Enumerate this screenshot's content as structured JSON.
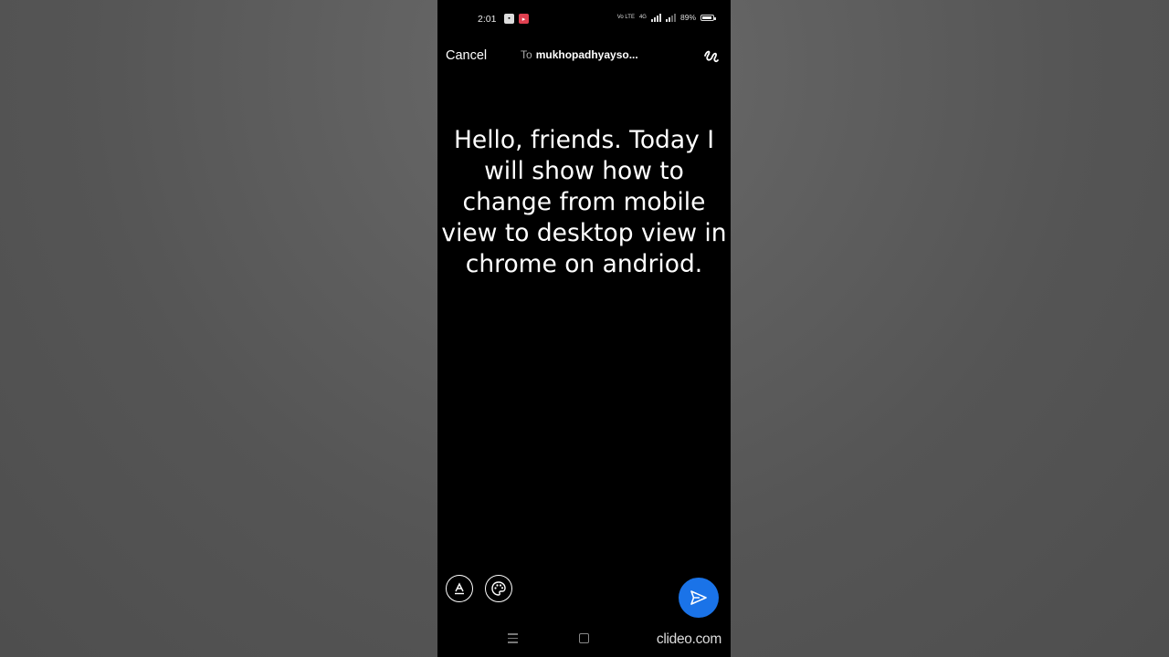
{
  "status_bar": {
    "time": "2:01",
    "notification_icons": [
      "chat-app-icon",
      "video-app-icon"
    ],
    "volte_label": "Vo LTE",
    "network_label": "4G",
    "battery_percent": "89%",
    "battery_level": 0.89
  },
  "compose": {
    "cancel_label": "Cancel",
    "to_label": "To",
    "recipient": "mukhopadhyayso...",
    "draw_icon": "squiggle-draw-icon"
  },
  "message": {
    "text": "Hello, friends. Today I will show how to change from mobile view to desktop view in chrome on andriod."
  },
  "toolbar": {
    "text_style_icon": "text-format-icon",
    "color_icon": "palette-icon",
    "send_icon": "send-icon",
    "send_color": "#1a73e8"
  },
  "nav_bar": {
    "menu_icon": "menu-icon",
    "home_icon": "home-icon"
  },
  "watermark": {
    "text": "clideo.com"
  }
}
